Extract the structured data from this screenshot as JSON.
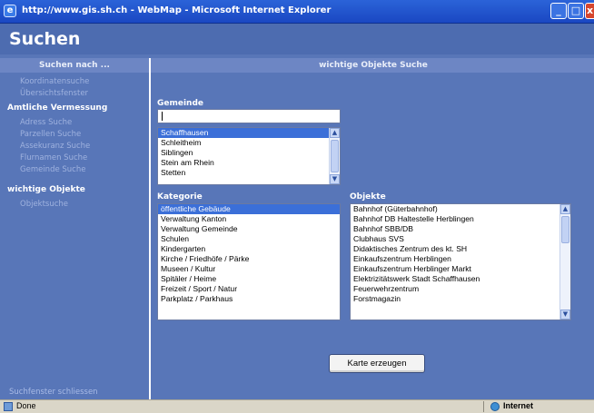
{
  "window": {
    "title": "http://www.gis.sh.ch - WebMap - Microsoft Internet Explorer",
    "min_glyph": "_",
    "max_glyph": "□",
    "close_glyph": "x"
  },
  "page": {
    "title": "Suchen",
    "left_header": "Suchen nach ...",
    "right_header": "wichtige Objekte Suche"
  },
  "sidebar": {
    "top_links": [
      "Koordinatensuche",
      "Übersichtsfenster"
    ],
    "section_1": "Amtliche Vermessung",
    "section_1_links": [
      "Adress Suche",
      "Parzellen Suche",
      "Assekuranz Suche",
      "Flurnamen Suche",
      "Gemeinde Suche"
    ],
    "section_2": "wichtige Objekte",
    "section_2_links": [
      "Objektsuche"
    ],
    "close_link": "Suchfenster schliessen"
  },
  "form": {
    "gemeinde_label": "Gemeinde",
    "gemeinde_input_value": "",
    "gemeinde_options": [
      "Schaffhausen",
      "Schleitheim",
      "Siblingen",
      "Stein am Rhein",
      "Stetten"
    ],
    "gemeinde_selected": "Schaffhausen",
    "kategorie_label": "Kategorie",
    "kategorie_options": [
      "öffentliche Gebäude",
      "Verwaltung Kanton",
      "Verwaltung Gemeinde",
      "Schulen",
      "Kindergarten",
      "Kirche / Friedhöfe / Pärke",
      "Museen / Kultur",
      "Spitäler / Heime",
      "Freizeit / Sport / Natur",
      "Parkplatz / Parkhaus"
    ],
    "kategorie_selected": "öffentliche Gebäude",
    "objekte_label": "Objekte",
    "objekte_options": [
      "Bahnhof (Güterbahnhof)",
      "Bahnhof DB Haltestelle Herblingen",
      "Bahnhof SBB/DB",
      "Clubhaus SVS",
      "Didaktisches Zentrum des kt. SH",
      "Einkaufszentrum Herblingen",
      "Einkaufszentrum Herblinger Markt",
      "Elektrizitätswerk Stadt Schaffhausen",
      "Feuerwehrzentrum",
      "Forstmagazin"
    ],
    "generate_button": "Karte erzeugen"
  },
  "statusbar": {
    "status_text": "Done",
    "zone_text": "Internet"
  },
  "colors": {
    "background": "#5876b8",
    "selection": "#3b6fd8",
    "titlebar": "#1a47c2"
  }
}
